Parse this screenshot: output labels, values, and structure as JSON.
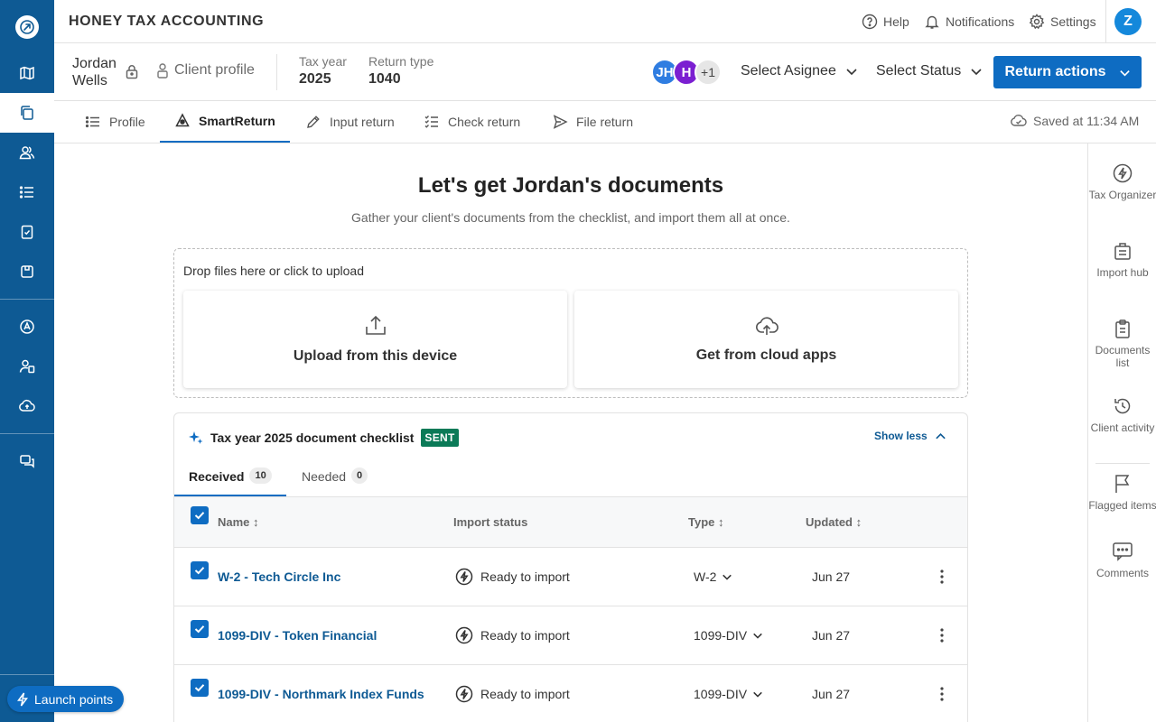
{
  "topbar": {
    "firm_name": "HONEY TAX ACCOUNTING",
    "help": "Help",
    "notifications": "Notifications",
    "settings": "Settings",
    "user_initial": "Z"
  },
  "client": {
    "first_name": "Jordan",
    "last_name": "Wells",
    "profile_link": "Client profile",
    "tax_year_label": "Tax year",
    "tax_year": "2025",
    "return_type_label": "Return type",
    "return_type": "1040",
    "assignees": [
      "JH",
      "H"
    ],
    "assignee_more": "+1",
    "select_assignee": "Select Asignee",
    "select_status": "Select Status",
    "return_actions": "Return actions"
  },
  "tabs": [
    {
      "label": "Profile",
      "icon": "list-icon"
    },
    {
      "label": "SmartReturn",
      "icon": "sparkle-icon",
      "active": true
    },
    {
      "label": "Input return",
      "icon": "pencil-icon"
    },
    {
      "label": "Check return",
      "icon": "checklist-icon"
    },
    {
      "label": "File return",
      "icon": "send-icon"
    }
  ],
  "saved_text": "Saved at 11:34 AM",
  "right_panel": [
    {
      "label": "Tax Organizer",
      "icon": "bolt-icon"
    },
    {
      "label": "Import hub",
      "icon": "import-icon"
    },
    {
      "label": "Documents list",
      "icon": "clipboard-icon"
    },
    {
      "label": "Client activity",
      "icon": "history-icon"
    },
    {
      "label": "Flagged items",
      "icon": "flag-icon"
    },
    {
      "label": "Comments",
      "icon": "comment-icon"
    }
  ],
  "main": {
    "heading": "Let's get Jordan's documents",
    "subheading": "Gather your client's documents from the checklist, and import them all at once.",
    "drop_label": "Drop files here or click to upload",
    "upload_device": "Upload from this device",
    "upload_cloud": "Get from cloud apps"
  },
  "checklist": {
    "title": "Tax year 2025 document checklist",
    "badge": "SENT",
    "show_less": "Show less",
    "tabs": [
      {
        "label": "Received",
        "count": "10"
      },
      {
        "label": "Needed",
        "count": "0"
      }
    ],
    "columns": {
      "name": "Name ↕",
      "status": "Import status",
      "type": "Type ↕",
      "updated": "Updated ↕"
    },
    "rows": [
      {
        "name": "W-2 - Tech Circle Inc",
        "status": "Ready to import",
        "type": "W-2",
        "updated": "Jun 27"
      },
      {
        "name": "1099-DIV - Token Financial",
        "status": "Ready to import",
        "type": "1099-DIV",
        "updated": "Jun 27"
      },
      {
        "name": "1099-DIV - Northmark Index Funds",
        "status": "Ready to import",
        "type": "1099-DIV",
        "updated": "Jun 27"
      }
    ]
  },
  "launch_points": "Launch points",
  "colors": {
    "brand": "#0e5a94",
    "accent": "#0e6cc2",
    "sent_badge": "#0b7a57",
    "avatar_jh": "#2f7de1",
    "avatar_h": "#7b1fd1"
  }
}
